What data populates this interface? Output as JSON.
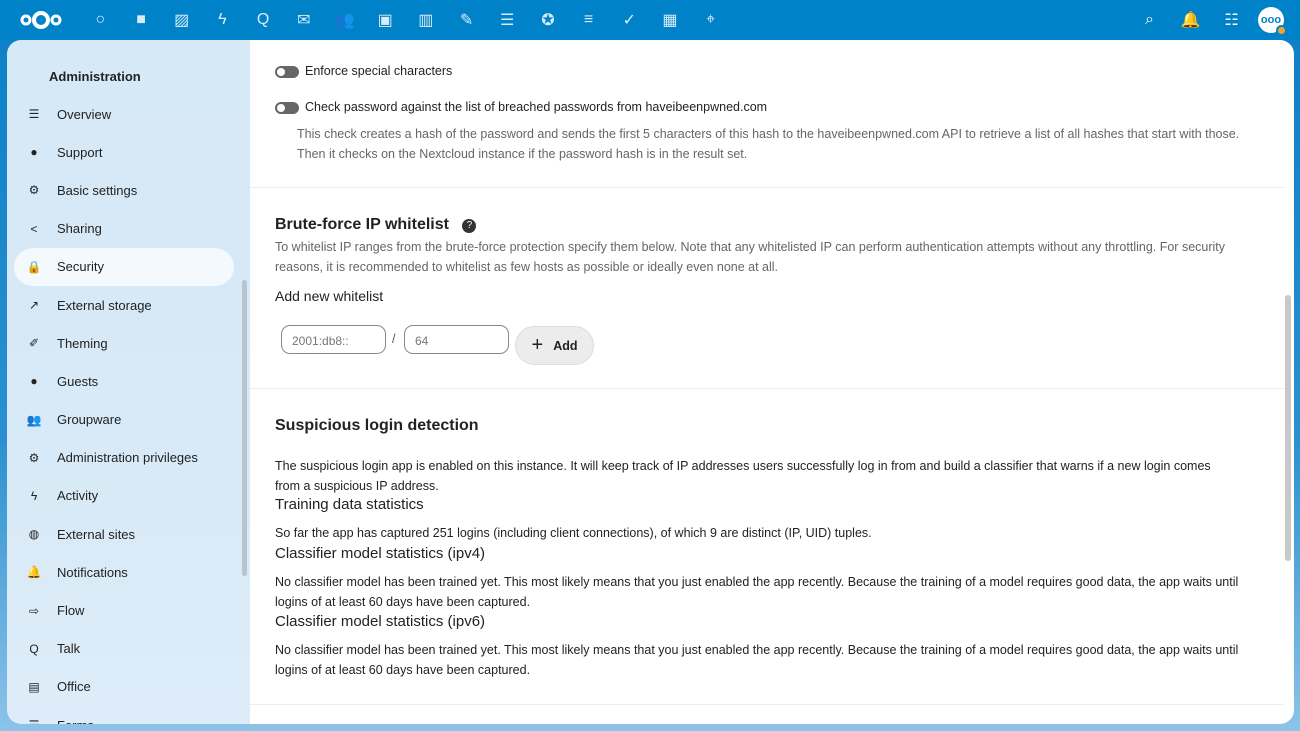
{
  "topbar": {
    "apps": [
      {
        "icon": "dashboard-icon",
        "glyph": "○"
      },
      {
        "icon": "files-icon",
        "glyph": "■"
      },
      {
        "icon": "photos-icon",
        "glyph": "▨"
      },
      {
        "icon": "activity-icon",
        "glyph": "ϟ"
      },
      {
        "icon": "talk-icon",
        "glyph": "Q"
      },
      {
        "icon": "mail-icon",
        "glyph": "✉"
      },
      {
        "icon": "contacts-icon",
        "glyph": "👥"
      },
      {
        "icon": "calendar-icon",
        "glyph": "▣"
      },
      {
        "icon": "analytics-icon",
        "glyph": "▥"
      },
      {
        "icon": "notes-icon",
        "glyph": "✎"
      },
      {
        "icon": "deck-icon",
        "glyph": "☰"
      },
      {
        "icon": "cospend-icon",
        "glyph": "✪"
      },
      {
        "icon": "tasks-list-icon",
        "glyph": "≡"
      },
      {
        "icon": "tasks-check-icon",
        "glyph": "✓"
      },
      {
        "icon": "tables-icon",
        "glyph": "▦"
      },
      {
        "icon": "maps-icon",
        "glyph": "⌖"
      }
    ],
    "right": [
      {
        "icon": "search-icon",
        "glyph": "⌕"
      },
      {
        "icon": "notifications-icon",
        "glyph": "🔔"
      },
      {
        "icon": "contacts-menu-icon",
        "glyph": "☷"
      }
    ],
    "avatar": "ooo"
  },
  "sidebar": {
    "title": "Administration",
    "items": [
      {
        "label": "Overview",
        "icon": "list-icon",
        "glyph": "☰"
      },
      {
        "label": "Support",
        "icon": "support-icon",
        "glyph": "●"
      },
      {
        "label": "Basic settings",
        "icon": "gear-icon",
        "glyph": "⚙"
      },
      {
        "label": "Sharing",
        "icon": "share-icon",
        "glyph": "<"
      },
      {
        "label": "Security",
        "icon": "lock-icon",
        "glyph": "🔒",
        "active": true
      },
      {
        "label": "External storage",
        "icon": "external-icon",
        "glyph": "↗"
      },
      {
        "label": "Theming",
        "icon": "brush-icon",
        "glyph": "✐"
      },
      {
        "label": "Guests",
        "icon": "user-icon",
        "glyph": "●"
      },
      {
        "label": "Groupware",
        "icon": "groupware-icon",
        "glyph": "👥"
      },
      {
        "label": "Administration privileges",
        "icon": "admin-icon",
        "glyph": "⚙"
      },
      {
        "label": "Activity",
        "icon": "activity-icon",
        "glyph": "ϟ"
      },
      {
        "label": "External sites",
        "icon": "globe-icon",
        "glyph": "◍"
      },
      {
        "label": "Notifications",
        "icon": "bell-icon",
        "glyph": "🔔"
      },
      {
        "label": "Flow",
        "icon": "flow-icon",
        "glyph": "⇨"
      },
      {
        "label": "Talk",
        "icon": "talk-icon",
        "glyph": "Q"
      },
      {
        "label": "Office",
        "icon": "office-icon",
        "glyph": "▤"
      },
      {
        "label": "Forms",
        "icon": "forms-icon",
        "glyph": "☰"
      }
    ]
  },
  "password": {
    "special": "Enforce special characters",
    "breached": "Check password against the list of breached passwords from haveibeenpwned.com",
    "breached_desc": "This check creates a hash of the password and sends the first 5 characters of this hash to the haveibeenpwned.com API to retrieve a list of all hashes that start with those. Then it checks on the Nextcloud instance if the password hash is in the result set."
  },
  "bruteforce": {
    "title": "Brute-force IP whitelist",
    "desc": "To whitelist IP ranges from the brute-force protection specify them below. Note that any whitelisted IP can perform authentication attempts without any throttling. For security reasons, it is recommended to whitelist as few hosts as possible or ideally even none at all.",
    "add_label": "Add new whitelist",
    "ip_placeholder": "2001:db8::",
    "mask_placeholder": "64",
    "slash": "/",
    "add_button": "Add"
  },
  "suspicious": {
    "title": "Suspicious login detection",
    "desc": "The suspicious login app is enabled on this instance. It will keep track of IP addresses users successfully log in from and build a classifier that warns if a new login comes from a suspicious IP address.",
    "training_title": "Training data statistics",
    "training_text": "So far the app has captured 251 logins (including client connections), of which 9 are distinct (IP, UID) tuples.",
    "ipv4_title": "Classifier model statistics (ipv4)",
    "ipv4_text": "No classifier model has been trained yet. This most likely means that you just enabled the app recently. Because the training of a model requires good data, the app waits until logins of at least 60 days have been captured.",
    "ipv6_title": "Classifier model statistics (ipv6)",
    "ipv6_text": "No classifier model has been trained yet. This most likely means that you just enabled the app recently. Because the training of a model requires good data, the app waits until logins of at least 60 days have been captured."
  }
}
